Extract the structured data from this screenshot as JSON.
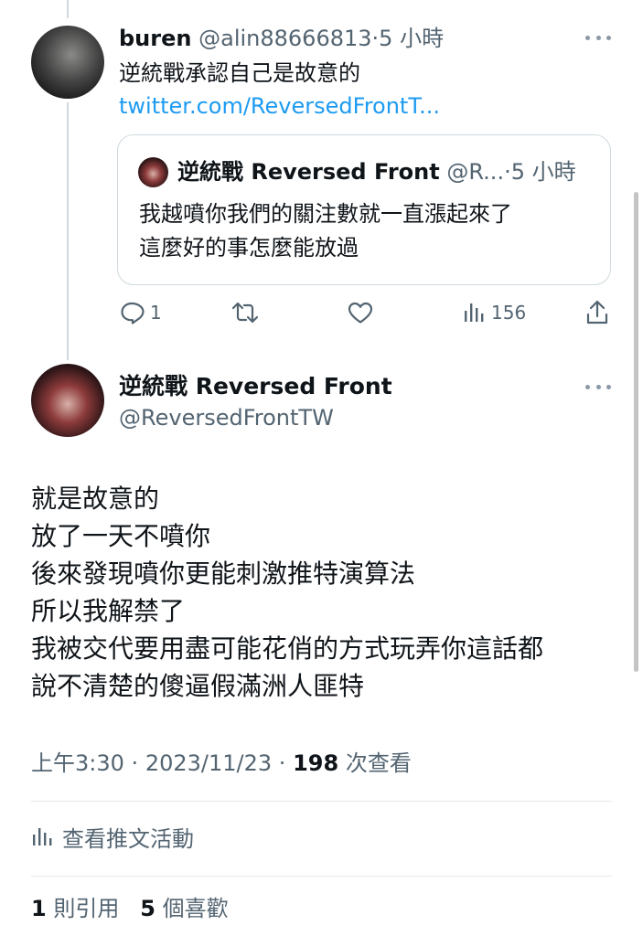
{
  "reply": {
    "display_name": "buren",
    "handle": "@alin88666813",
    "separator": "·",
    "time": "5 小時",
    "text": "逆統戰承認自己是故意的",
    "link": "twitter.com/ReversedFrontT..."
  },
  "quoted": {
    "display_name": "逆統戰 Reversed Front",
    "handle": "@R...",
    "separator": "·",
    "time": "5 小時",
    "text": "我越噴你我們的關注數就一直漲起來了\n這麼好的事怎麼能放過"
  },
  "reply_actions": {
    "reply_icon": "reply-icon",
    "reply_count": "1",
    "retweet_icon": "retweet-icon",
    "like_icon": "heart-icon",
    "views_icon": "views-icon",
    "views_count": "156",
    "share_icon": "share-icon"
  },
  "main": {
    "display_name": "逆統戰 Reversed Front",
    "handle": "@ReversedFrontTW",
    "text": "就是故意的\n放了一天不噴你\n後來發現噴你更能刺激推特演算法\n所以我解禁了\n我被交代要用盡可能花俏的方式玩弄你這話都\n說不清楚的傻逼假滿洲人匪特",
    "time": "上午3:30",
    "date": "2023/11/23",
    "separator": "·",
    "views_count": "198",
    "views_label": "次查看",
    "activity_label": "查看推文活動",
    "quotes_count": "1",
    "quotes_label": "則引用",
    "likes_count": "5",
    "likes_label": "個喜歡"
  },
  "colors": {
    "text": "#0f1419",
    "muted": "#536471",
    "link": "#1d9bf0",
    "border": "#cfd9de"
  }
}
